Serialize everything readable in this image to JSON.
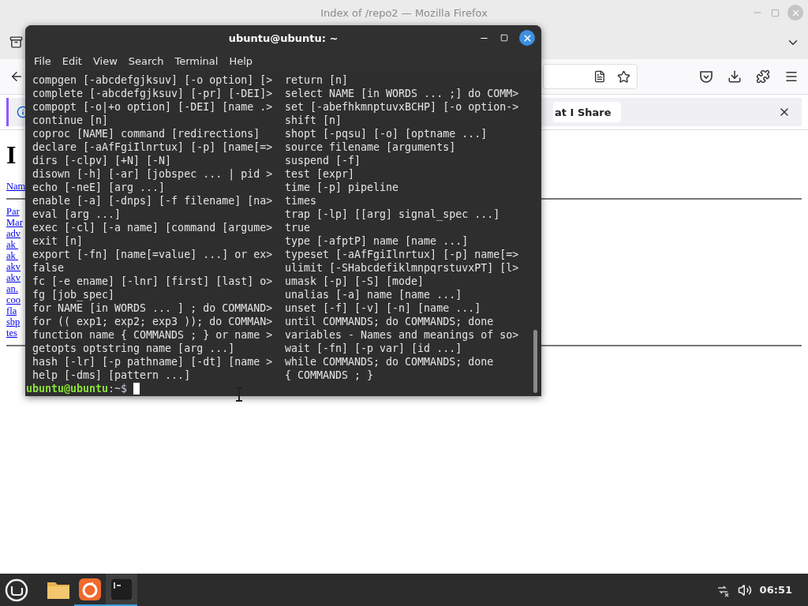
{
  "browser": {
    "title": "Index of /repo2 — Mozilla Firefox",
    "notification": {
      "button": "at I Share"
    },
    "page": {
      "heading": "I",
      "header_link": "Nam",
      "links": [
        "Par",
        "Mar",
        "adv",
        "ak ",
        "ak ",
        "akv",
        "akv",
        "an.",
        "coo",
        "fla",
        "sbp",
        "tes"
      ]
    }
  },
  "terminal": {
    "title": "ubuntu@ubuntu: ~",
    "menu": [
      "File",
      "Edit",
      "View",
      "Search",
      "Terminal",
      "Help"
    ],
    "left_column": [
      "compgen [-abcdefgjksuv] [-o option] [>",
      "complete [-abcdefgjksuv] [-pr] [-DEI]>",
      "compopt [-o|+o option] [-DEI] [name .>",
      "continue [n]",
      "coproc [NAME] command [redirections]",
      "declare [-aAfFgiIlnrtux] [-p] [name[=>",
      "dirs [-clpv] [+N] [-N]",
      "disown [-h] [-ar] [jobspec ... | pid >",
      "echo [-neE] [arg ...]",
      "enable [-a] [-dnps] [-f filename] [na>",
      "eval [arg ...]",
      "exec [-cl] [-a name] [command [argume>",
      "exit [n]",
      "export [-fn] [name[=value] ...] or ex>",
      "false",
      "fc [-e ename] [-lnr] [first] [last] o>",
      "fg [job_spec]",
      "for NAME [in WORDS ... ] ; do COMMAND>",
      "for (( exp1; exp2; exp3 )); do COMMAN>",
      "function name { COMMANDS ; } or name >",
      "getopts optstring name [arg ...]",
      "hash [-lr] [-p pathname] [-dt] [name >",
      "help [-dms] [pattern ...]"
    ],
    "right_column": [
      "return [n]",
      "select NAME [in WORDS ... ;] do COMM>",
      "set [-abefhkmnptuvxBCHP] [-o option->",
      "shift [n]",
      "shopt [-pqsu] [-o] [optname ...]",
      "source filename [arguments]",
      "suspend [-f]",
      "test [expr]",
      "time [-p] pipeline",
      "times",
      "trap [-lp] [[arg] signal_spec ...]",
      "true",
      "type [-afptP] name [name ...]",
      "typeset [-aAfFgiIlnrtux] [-p] name[=>",
      "ulimit [-SHabcdefiklmnpqrstuvxPT] [l>",
      "umask [-p] [-S] [mode]",
      "unalias [-a] name [name ...]",
      "unset [-f] [-v] [-n] [name ...]",
      "until COMMANDS; do COMMANDS; done",
      "variables - Names and meanings of so>",
      "wait [-fn] [-p var] [id ...]",
      "while COMMANDS; do COMMANDS; done",
      "{ COMMANDS ; }"
    ],
    "prompt": {
      "user": "ubuntu@ubuntu",
      "path": ":~$"
    }
  },
  "taskbar": {
    "apps": [
      {
        "kind": "folder",
        "running": false,
        "active": false
      },
      {
        "kind": "firefox",
        "running": true,
        "active": false
      },
      {
        "kind": "terminal",
        "running": true,
        "active": true
      }
    ],
    "clock": "06:51"
  }
}
